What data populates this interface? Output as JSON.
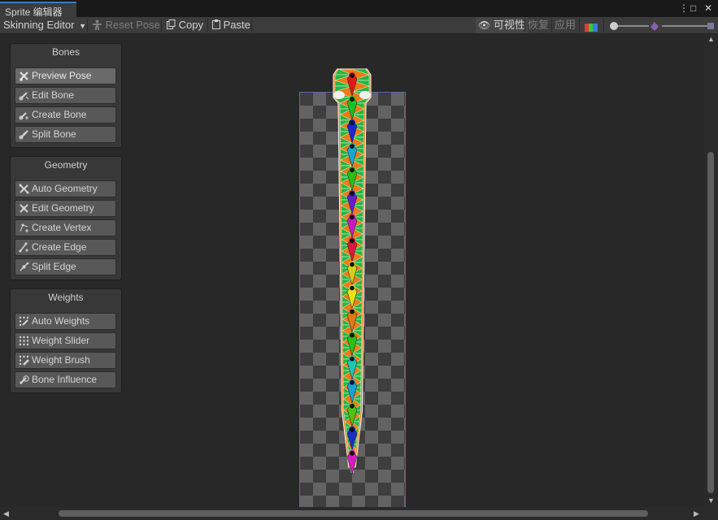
{
  "window": {
    "tab_title": "Sprite 编辑器",
    "menu_glyph": "⋮",
    "maximize_glyph": "□",
    "close_glyph": "✕"
  },
  "toolbar": {
    "mode_dropdown": "Skinning Editor",
    "reset_pose": "Reset Pose",
    "copy": "Copy",
    "paste": "Paste",
    "visibility": "可视性",
    "revert": "恢复",
    "apply": "应用",
    "zoom_level": 0.15
  },
  "panels": {
    "bones": {
      "title": "Bones",
      "buttons": [
        "Preview Pose",
        "Edit Bone",
        "Create Bone",
        "Split Bone"
      ],
      "icons": [
        "preview-pose-icon",
        "edit-bone-icon",
        "create-bone-icon",
        "split-bone-icon"
      ],
      "active": 0
    },
    "geometry": {
      "title": "Geometry",
      "buttons": [
        "Auto Geometry",
        "Edit Geometry",
        "Create Vertex",
        "Create Edge",
        "Split Edge"
      ],
      "icons": [
        "auto-geometry-icon",
        "edit-geometry-icon",
        "create-vertex-icon",
        "create-edge-icon",
        "split-edge-icon"
      ]
    },
    "weights": {
      "title": "Weights",
      "buttons": [
        "Auto Weights",
        "Weight Slider",
        "Weight Brush",
        "Bone Influence"
      ],
      "icons": [
        "auto-weights-icon",
        "weight-slider-icon",
        "weight-brush-icon",
        "bone-influence-icon"
      ]
    }
  },
  "bones": {
    "colors": [
      "#e0141a",
      "#12c424",
      "#1022d8",
      "#12a8d8",
      "#1cc214",
      "#5a1bd8",
      "#c815c8",
      "#d8143c",
      "#d4d41a",
      "#e8e814",
      "#e07814",
      "#22c414",
      "#14c8c0",
      "#14a0e0",
      "#48c414",
      "#1428c8",
      "#d814c8"
    ]
  },
  "colors": {
    "mesh_fill": "#27b542",
    "mesh_edge": "#e8ffe8",
    "weight_orange": "#ee7a18",
    "accent": "#3a79bb"
  }
}
